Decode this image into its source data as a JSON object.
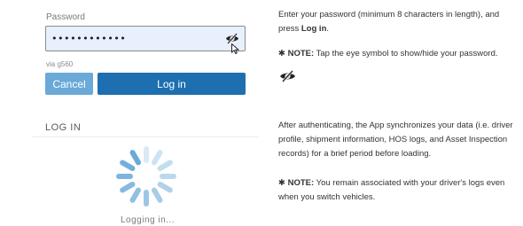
{
  "top_cut_text": "(partially visible)",
  "login_form": {
    "password_label": "Password",
    "password_value": "••••••••••••",
    "device_text": "via g560",
    "cancel_label": "Cancel",
    "login_label": "Log in"
  },
  "status": {
    "section_title": "LOG IN",
    "loading_text": "Logging in..."
  },
  "instructions": {
    "step1_text": "Enter your password (minimum 8 characters in length), and press ",
    "step1_bold": "Log in",
    "step1_end": ".",
    "note1_prefix": "✱ NOTE:",
    "note1_text": " Tap the eye symbol to show/hide your password.",
    "step2_text": "After authenticating, the App synchronizes your data (i.e. driver profile, shipment information, HOS logs, and Asset Inspection records) for a brief period before loading.",
    "note2_prefix": "✱ NOTE:",
    "note2_text": " You remain associated with your driver's logs even when you switch vehicles."
  },
  "colors": {
    "field_bg": "#e8f0fe",
    "cancel_bg": "#6aa9d8",
    "login_bg": "#1e6fb0",
    "spinner": "#6aa9d8"
  },
  "icons": {
    "eye_toggle": "eye-slash-icon",
    "spinner": "loading-spinner-icon",
    "cursor": "mouse-pointer-icon"
  }
}
